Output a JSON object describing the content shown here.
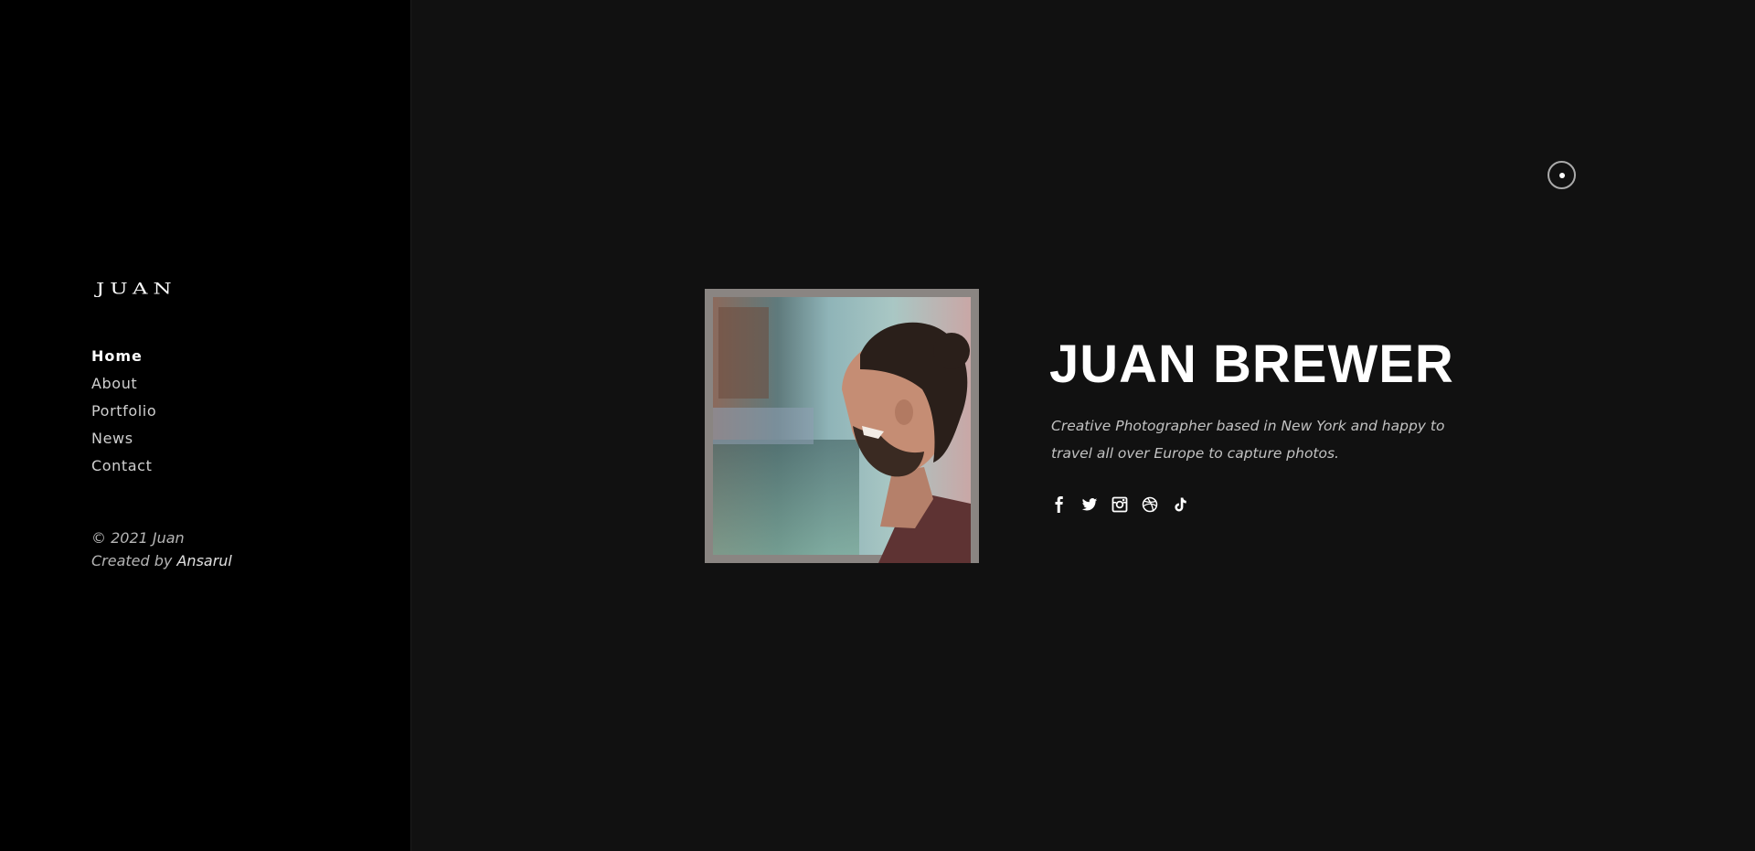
{
  "sidebar": {
    "logo": "JUAN",
    "nav": [
      {
        "label": "Home",
        "active": true
      },
      {
        "label": "About"
      },
      {
        "label": "Portfolio"
      },
      {
        "label": "News"
      },
      {
        "label": "Contact"
      }
    ],
    "copyright": "© 2021 Juan",
    "created_by_prefix": "Created by",
    "created_by_name": "Ansarul"
  },
  "hero": {
    "name": "JUAN BREWER",
    "bio": "Creative Photographer based in New York and happy to travel all over Europe to capture photos.",
    "photo": "portrait-photo",
    "social": [
      {
        "icon": "facebook-icon"
      },
      {
        "icon": "twitter-icon"
      },
      {
        "icon": "instagram-icon"
      },
      {
        "icon": "dribbble-icon"
      },
      {
        "icon": "tiktok-icon"
      }
    ]
  },
  "controls": {
    "mode_toggle_icon": "theme-toggle-icon"
  },
  "colors": {
    "sidebar_bg": "#000000",
    "main_bg": "#111111",
    "text_primary": "#ffffff",
    "text_secondary": "#c2c2c2"
  }
}
